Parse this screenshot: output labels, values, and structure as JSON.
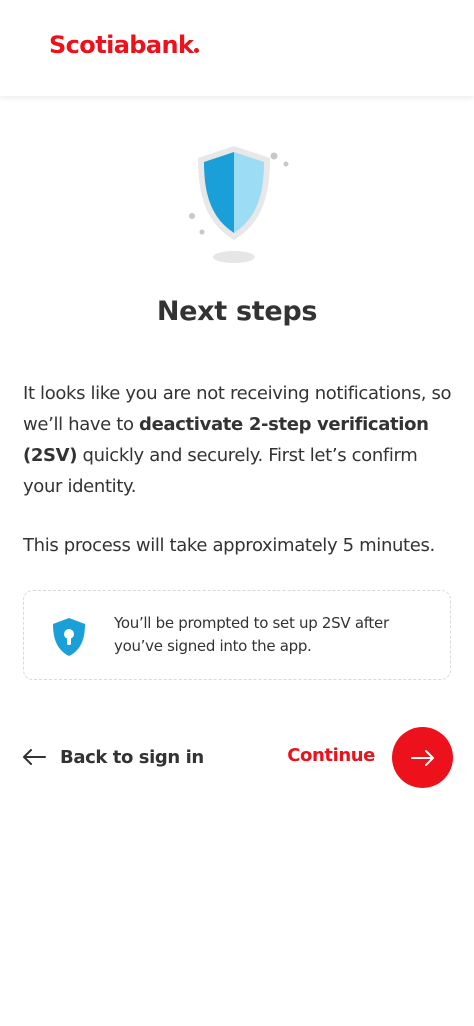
{
  "header": {
    "brand": "Scotiabank"
  },
  "main": {
    "title": "Next steps",
    "paragraph1_start": "It looks like you are not receiving notifications, so we’ll have to ",
    "paragraph1_bold": "deactivate 2-step verification (2SV)",
    "paragraph1_end": " quickly and securely. First let’s confirm your identity.",
    "paragraph2": "This process will take approximately 5 minutes."
  },
  "info_card": {
    "icon": "shield-lock-icon",
    "text": "You’ll be prompted to set up 2SV after you’ve signed into the app."
  },
  "actions": {
    "back_label": "Back to sign in",
    "continue_label": "Continue"
  },
  "colors": {
    "brand_red": "#ec111a",
    "shield_blue": "#1a9fd9",
    "shield_light": "#9ddcf5",
    "text": "#333333"
  }
}
